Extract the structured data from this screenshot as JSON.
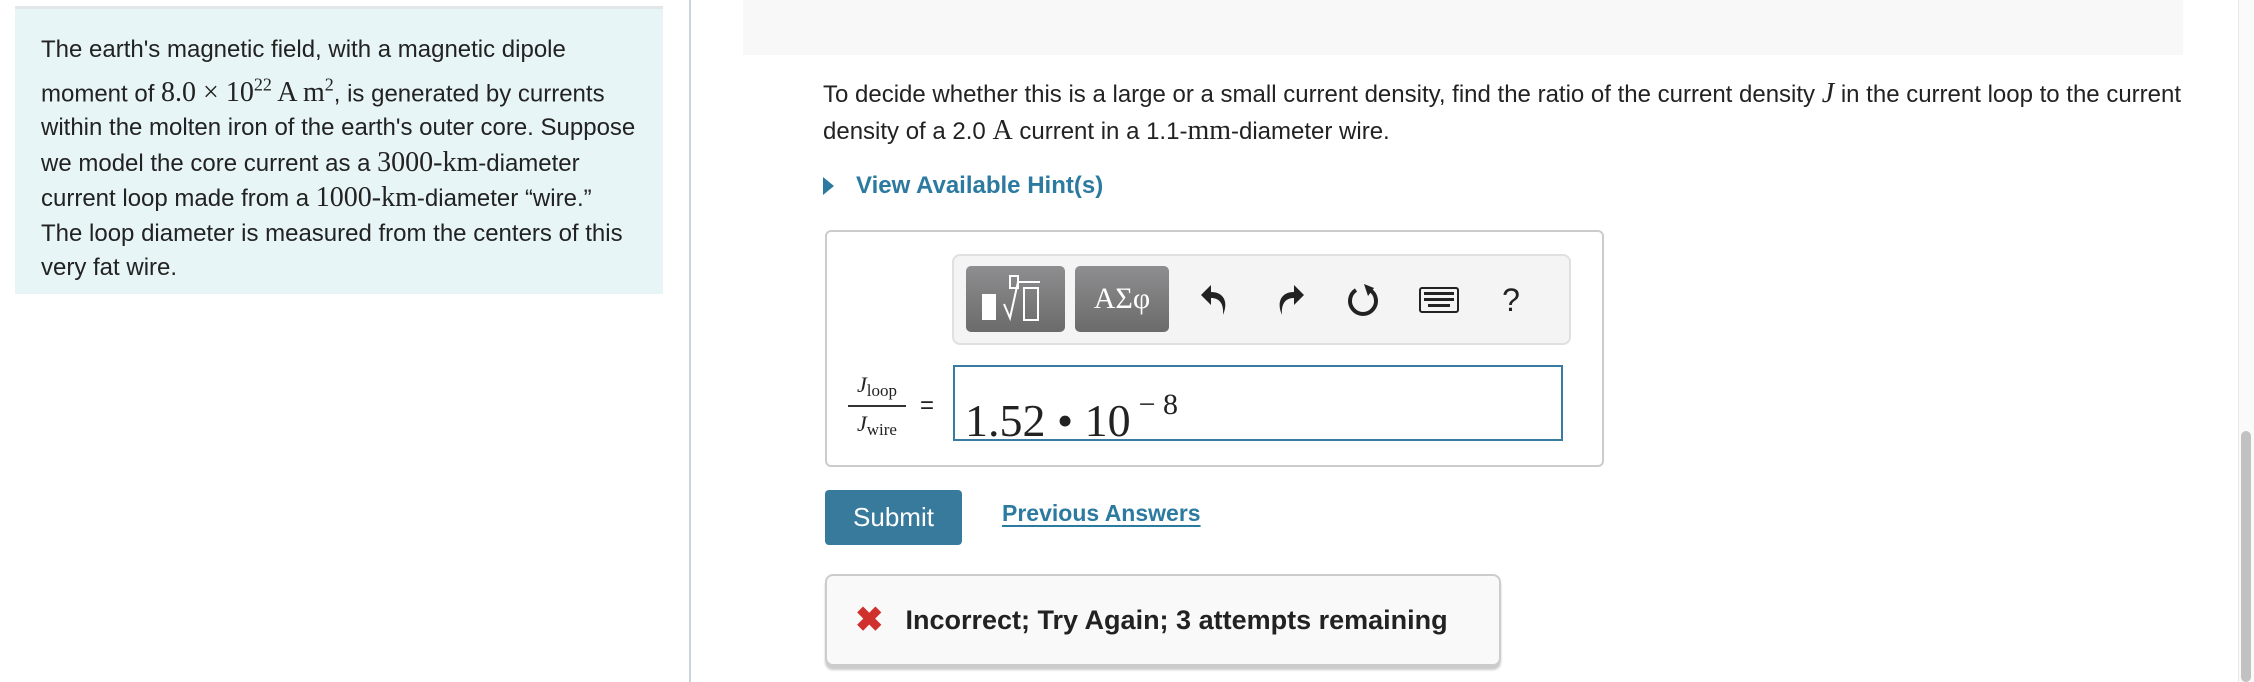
{
  "problem": {
    "t1": "The earth's magnetic field, with a magnetic dipole moment of ",
    "m1": "8.0 × 10",
    "m1_exp": "22",
    "m2": " A m",
    "m2_exp": "2",
    "t2": ", is generated by currents within the molten iron of the earth's outer core. Suppose we model the core current as a ",
    "m3": "3000-km",
    "t3": "-diameter current loop made from a ",
    "m4": "1000-km",
    "t4": "-diameter “wire.” The loop diameter is measured from the centers of this very fat wire."
  },
  "question": {
    "t1": "To decide whether this is a large or a small current density, find the ratio of the current density ",
    "var": "J",
    "t2": " in the current loop to the current density of a 2.0 ",
    "unit": "A",
    "t3": " current in a 1.1-",
    "mm": "mm",
    "t4": "-diameter wire."
  },
  "hint_label": "View Available Hint(s)",
  "toolbar": {
    "templates_icon": "fraction-root-icon",
    "greek_label": "ΑΣφ",
    "undo_icon": "undo-icon",
    "redo_icon": "redo-icon",
    "reset_icon": "reset-icon",
    "keyboard_icon": "keyboard-icon",
    "help_label": "?"
  },
  "answer": {
    "label_num": "J",
    "label_num_sub": "loop",
    "label_den": "J",
    "label_den_sub": "wire",
    "equals": "=",
    "mantissa": "1.52 • 10",
    "exponent": "− 8"
  },
  "submit_label": "Submit",
  "previous_answers_label": "Previous Answers",
  "feedback": {
    "icon": "x-icon",
    "text": "Incorrect; Try Again; 3 attempts remaining",
    "color": "#d0312d"
  },
  "colors": {
    "accent": "#387a9c",
    "link": "#2c7aa0",
    "panel": "#e8f5f6"
  }
}
